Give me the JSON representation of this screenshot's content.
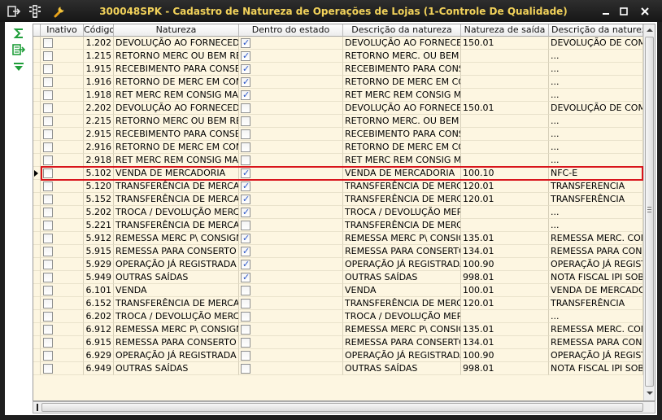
{
  "window": {
    "title": "300048SPK - Cadastro de Natureza de Operações de Lojas (1-Controle De Qualidade)",
    "title_color": "#f2d25a",
    "icons": [
      "export-icon",
      "traffic-light-icon",
      "wrench-icon"
    ],
    "controls": [
      "minimize-icon",
      "maximize-icon",
      "close-icon"
    ]
  },
  "side_toolbar": {
    "buttons": [
      "sum-icon",
      "export-records-icon",
      "collapse-down-icon"
    ],
    "accent_color": "#1f9e3a"
  },
  "grid": {
    "columns": [
      "Inativo",
      "Código",
      "Natureza",
      "Dentro do estado",
      "Descrição da natureza",
      "Natureza de saída",
      "Descrição da natureza de"
    ],
    "selected_row_index": 11,
    "selection_color": "#d8141b",
    "row_background": "#fdf6e1",
    "rows": [
      {
        "inativo": false,
        "codigo": "1.202",
        "natureza": "DEVOLUÇÃO AO FORNECEDOR",
        "dentro": true,
        "descricao": "DEVOLUÇÃO AO FORNECEDOR",
        "saida": "150.01",
        "descricao_saida": "DEVOLUÇÃO DE COMPRA"
      },
      {
        "inativo": false,
        "codigo": "1.215",
        "natureza": "RETORNO MERC OU BEM RECEB",
        "dentro": true,
        "descricao": "RETORNO MERC. OU BEM REC",
        "saida": "",
        "descricao_saida": "..."
      },
      {
        "inativo": false,
        "codigo": "1.915",
        "natureza": "RECEBIMENTO PARA CONSERTO",
        "dentro": true,
        "descricao": "RECEBIMENTO PARA CONSERTO",
        "saida": "",
        "descricao_saida": "..."
      },
      {
        "inativo": false,
        "codigo": "1.916",
        "natureza": "RETORNO DE MERC EM CONSERTO",
        "dentro": true,
        "descricao": "RETORNO DE MERC EM CONSIG",
        "saida": "",
        "descricao_saida": "..."
      },
      {
        "inativo": false,
        "codigo": "1.918",
        "natureza": "RET MERC REM CONSIG MARC.",
        "dentro": true,
        "descricao": "RET MERC REM CONSIG MAR",
        "saida": "",
        "descricao_saida": "..."
      },
      {
        "inativo": false,
        "codigo": "2.202",
        "natureza": "DEVOLUÇÃO AO FORNECEDOR",
        "dentro": false,
        "descricao": "DEVOLUÇÃO AO FORNECEDOR",
        "saida": "150.01",
        "descricao_saida": "DEVOLUÇÃO DE COMPRA"
      },
      {
        "inativo": false,
        "codigo": "2.215",
        "natureza": "RETORNO MERC OU BEM RECEB",
        "dentro": false,
        "descricao": "RETORNO MERC. OU BEM REC",
        "saida": "",
        "descricao_saida": "..."
      },
      {
        "inativo": false,
        "codigo": "2.915",
        "natureza": "RECEBIMENTO PARA CONSERTO",
        "dentro": false,
        "descricao": "RECEBIMENTO PARA CONSERTO",
        "saida": "",
        "descricao_saida": "..."
      },
      {
        "inativo": false,
        "codigo": "2.916",
        "natureza": "RETORNO DE MERC EM CONSERTO",
        "dentro": false,
        "descricao": "RETORNO DE MERC EM CONSIG",
        "saida": "",
        "descricao_saida": "..."
      },
      {
        "inativo": false,
        "codigo": "2.918",
        "natureza": "RET MERC REM CONSIG MARC.",
        "dentro": false,
        "descricao": "RET MERC REM CONSIG MAR",
        "saida": "",
        "descricao_saida": "..."
      },
      {
        "inativo": false,
        "codigo": "5.102",
        "natureza": "VENDA DE MERCADORIA",
        "dentro": true,
        "descricao": "VENDA DE MERCADORIA",
        "saida": "100.10",
        "descricao_saida": "NFC-E"
      },
      {
        "inativo": false,
        "codigo": "5.120",
        "natureza": "TRANSFERÊNCIA DE MERCADORIA",
        "dentro": true,
        "descricao": "TRANSFERÊNCIA DE MERCAD",
        "saida": "120.01",
        "descricao_saida": "TRANSFERENCIA"
      },
      {
        "inativo": false,
        "codigo": "5.152",
        "natureza": "TRANSFERÊNCIA DE MERCADORIA",
        "dentro": true,
        "descricao": "TRANSFERÊNCIA DE MERCAD",
        "saida": "120.01",
        "descricao_saida": "TRANSFERÊNCIA"
      },
      {
        "inativo": false,
        "codigo": "5.202",
        "natureza": "TROCA / DEVOLUÇÃO MERCADORIA",
        "dentro": true,
        "descricao": "TROCA / DEVOLUÇÃO MERCAD",
        "saida": "",
        "descricao_saida": "..."
      },
      {
        "inativo": false,
        "codigo": "5.221",
        "natureza": "TRANSFERÊNCIA DE MERCADORIA",
        "dentro": false,
        "descricao": "TRANSFERÊNCIA DE MERCAD",
        "saida": "",
        "descricao_saida": "..."
      },
      {
        "inativo": false,
        "codigo": "5.912",
        "natureza": "REMESSA MERC P\\ CONSIGNAÇÃO",
        "dentro": true,
        "descricao": "REMESSA MERC P\\ CONSIGN",
        "saida": "135.01",
        "descricao_saida": "REMESSA MERC. CONSIG"
      },
      {
        "inativo": false,
        "codigo": "5.915",
        "natureza": "REMESSA PARA CONSERTO",
        "dentro": true,
        "descricao": "REMESSA PARA CONSERTO",
        "saida": "134.01",
        "descricao_saida": "REMESSA PARA CONSERT"
      },
      {
        "inativo": false,
        "codigo": "5.929",
        "natureza": "OPERAÇÃO JÁ REGISTRADA EM",
        "dentro": true,
        "descricao": "OPERAÇÃO JÁ REGISTRADA",
        "saida": "100.90",
        "descricao_saida": "OPERAÇÃO JÁ REGISTRA"
      },
      {
        "inativo": false,
        "codigo": "5.949",
        "natureza": "OUTRAS SAÍDAS",
        "dentro": true,
        "descricao": "OUTRAS SAÍDAS",
        "saida": "998.01",
        "descricao_saida": "NOTA FISCAL IPI SOBRE"
      },
      {
        "inativo": false,
        "codigo": "6.101",
        "natureza": "VENDA",
        "dentro": false,
        "descricao": "VENDA",
        "saida": "100.01",
        "descricao_saida": "VENDA DE MERCADORIA"
      },
      {
        "inativo": false,
        "codigo": "6.152",
        "natureza": "TRANSFERÊNCIA DE MERCADORIA",
        "dentro": false,
        "descricao": "TRANSFERÊNCIA DE MERCAD",
        "saida": "120.01",
        "descricao_saida": "TRANSFERÊNCIA"
      },
      {
        "inativo": false,
        "codigo": "6.202",
        "natureza": "TROCA / DEVOLUÇÃO MERCADORIA",
        "dentro": false,
        "descricao": "TROCA / DEVOLUÇÃO MERCAD",
        "saida": "",
        "descricao_saida": "..."
      },
      {
        "inativo": false,
        "codigo": "6.912",
        "natureza": "REMESSA MERC P\\ CONSIGNAÇÃO",
        "dentro": false,
        "descricao": "REMESSA MERC P\\ CONSIGN",
        "saida": "135.01",
        "descricao_saida": "REMESSA MERC. CONSIG"
      },
      {
        "inativo": false,
        "codigo": "6.915",
        "natureza": "REMESSA PARA CONSERTO",
        "dentro": false,
        "descricao": "REMESSA PARA CONSERTO",
        "saida": "134.01",
        "descricao_saida": "REMESSA PARA CONSERT"
      },
      {
        "inativo": false,
        "codigo": "6.929",
        "natureza": "OPERAÇÃO JÁ REGISTRADA EM",
        "dentro": false,
        "descricao": "OPERAÇÃO JÁ REGISTRADA",
        "saida": "100.90",
        "descricao_saida": "OPERAÇÃO JÁ REGISTRA"
      },
      {
        "inativo": false,
        "codigo": "6.949",
        "natureza": "OUTRAS SAÍDAS",
        "dentro": false,
        "descricao": "OUTRAS SAÍDAS",
        "saida": "998.01",
        "descricao_saida": "NOTA FISCAL IPI SOBRE"
      }
    ]
  }
}
